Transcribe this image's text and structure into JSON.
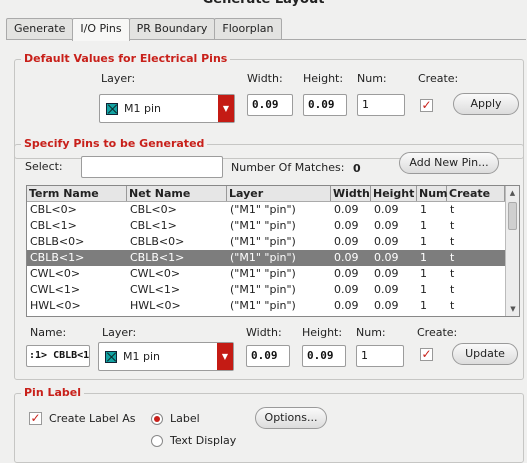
{
  "window": {
    "title": "Generate Layout"
  },
  "tabs": [
    {
      "label": "Generate"
    },
    {
      "label": "I/O Pins"
    },
    {
      "label": "PR Boundary"
    },
    {
      "label": "Floorplan"
    }
  ],
  "defaults": {
    "title": "Default Values for Electrical Pins",
    "layer_label": "Layer:",
    "layer_value": "M1 pin",
    "width_label": "Width:",
    "width_value": "0.09",
    "height_label": "Height:",
    "height_value": "0.09",
    "num_label": "Num:",
    "num_value": "1",
    "create_label": "Create:",
    "create_checked": true,
    "apply_label": "Apply"
  },
  "specify": {
    "title": "Specify Pins to be Generated",
    "select_label": "Select:",
    "select_value": "",
    "matches_label": "Number Of Matches:",
    "matches_value": "0",
    "add_button": "Add New Pin...",
    "columns": [
      "Term Name",
      "Net Name",
      "Layer",
      "Width",
      "Height",
      "Num",
      "Create"
    ],
    "rows": [
      [
        "CBL<0>",
        "CBL<0>",
        "(\"M1\" \"pin\")",
        "0.09",
        "0.09",
        "1",
        "t"
      ],
      [
        "CBL<1>",
        "CBL<1>",
        "(\"M1\" \"pin\")",
        "0.09",
        "0.09",
        "1",
        "t"
      ],
      [
        "CBLB<0>",
        "CBLB<0>",
        "(\"M1\" \"pin\")",
        "0.09",
        "0.09",
        "1",
        "t"
      ],
      [
        "CBLB<1>",
        "CBLB<1>",
        "(\"M1\" \"pin\")",
        "0.09",
        "0.09",
        "1",
        "t"
      ],
      [
        "CWL<0>",
        "CWL<0>",
        "(\"M1\" \"pin\")",
        "0.09",
        "0.09",
        "1",
        "t"
      ],
      [
        "CWL<1>",
        "CWL<1>",
        "(\"M1\" \"pin\")",
        "0.09",
        "0.09",
        "1",
        "t"
      ],
      [
        "HWL<0>",
        "HWL<0>",
        "(\"M1\" \"pin\")",
        "0.09",
        "0.09",
        "1",
        "t"
      ]
    ],
    "selected_row": 3,
    "name_label": "Name:",
    "name_value": ":1> CBLB<1",
    "layer_label": "Layer:",
    "layer_value": "M1 pin",
    "width_label": "Width:",
    "width_value": "0.09",
    "height_label": "Height:",
    "height_value": "0.09",
    "num_label": "Num:",
    "num_value": "1",
    "create_label": "Create:",
    "create_checked": true,
    "update_label": "Update"
  },
  "pinlabel": {
    "title": "Pin Label",
    "create_label_as": "Create Label As",
    "create_checked": true,
    "label_option": "Label",
    "text_display_option": "Text Display",
    "selected_option": "Label",
    "options_button": "Options..."
  },
  "colors": {
    "accent": "#c8201a",
    "layer_swatch": "#13a3a3",
    "selected_row": "#7d7d7d"
  }
}
